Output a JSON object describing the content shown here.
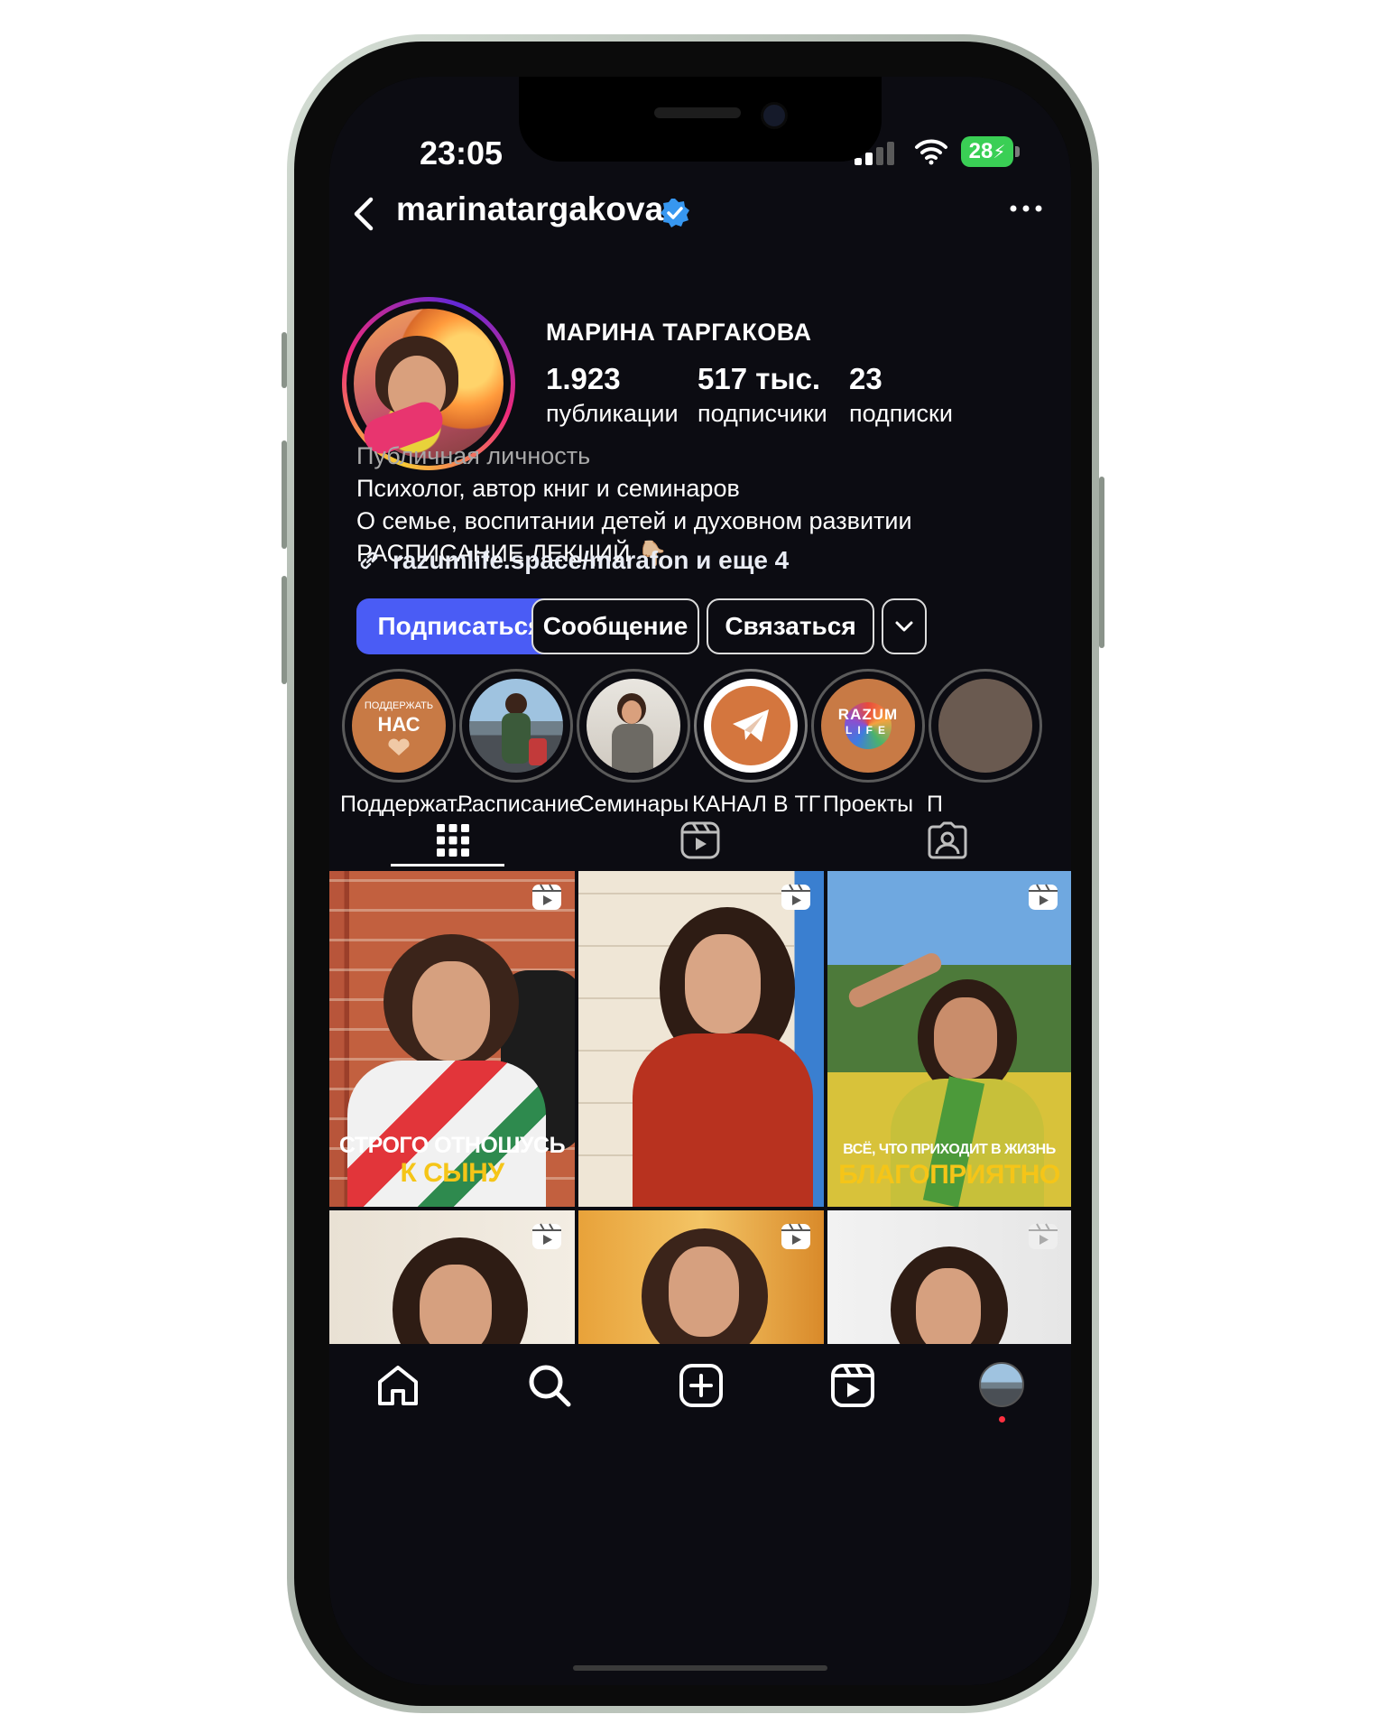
{
  "status": {
    "time": "23:05",
    "battery": "28"
  },
  "header": {
    "username": "marinatargakova"
  },
  "profile": {
    "display_name": "МАРИНА ТАРГАКОВА",
    "stats": [
      {
        "value": "1.923",
        "label": "публикации"
      },
      {
        "value": "517 тыс.",
        "label": "подписчики"
      },
      {
        "value": "23",
        "label": "подписки"
      }
    ],
    "category": "Публичная личность",
    "bio": [
      "Психолог, автор книг и семинаров",
      "О семье, воспитании детей и духовном развитии",
      "РАСПИСАНИЕ ЛЕКЦИЙ 👇🏼"
    ],
    "link": "razumlife.space/marafon и еще 4"
  },
  "actions": {
    "follow": "Подписаться",
    "message": "Сообщение",
    "contact": "Связаться"
  },
  "highlights": [
    {
      "label": "Поддержат...",
      "cover_text": [
        "ПОДДЕРЖАТЬ",
        "НАС"
      ]
    },
    {
      "label": "Расписание"
    },
    {
      "label": "Семинары"
    },
    {
      "label": "КАНАЛ В ТГ"
    },
    {
      "label": "Проекты",
      "cover_text": [
        "RAZUM",
        "LIFE"
      ]
    },
    {
      "label": "П"
    }
  ],
  "posts": [
    {
      "caption_line1": "СТРОГО ОТНОШУСЬ",
      "caption_line2": "К СЫНУ"
    },
    {},
    {
      "caption_line1": "ВСЁ, ЧТО ПРИХОДИТ В ЖИЗНЬ",
      "caption_line2": "БЛАГОПРИЯТНО"
    },
    {},
    {},
    {}
  ],
  "colors": {
    "follow_button": "#4a5cf5",
    "verified": "#3797f0",
    "battery": "#3acf55",
    "background": "#0c0c12"
  },
  "icons": [
    "back-icon",
    "verified-icon",
    "more-icon",
    "link-icon",
    "chevron-down-icon",
    "grid-icon",
    "reels-icon",
    "tagged-icon",
    "home-icon",
    "search-icon",
    "create-icon",
    "reels-nav-icon",
    "profile-avatar-icon"
  ]
}
